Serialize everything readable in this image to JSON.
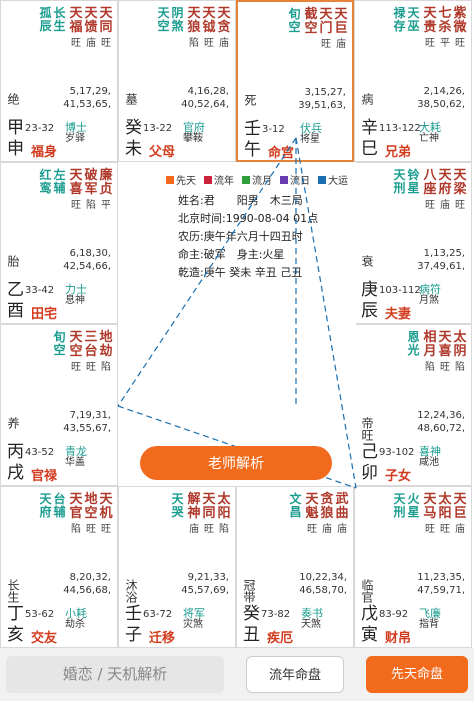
{
  "colors": {
    "accent": "#f26a1b",
    "palace": "#d23c1e",
    "major_star": "#b0382a",
    "minor_star": "#1a9d8f",
    "lucky": "#1a6fb0",
    "transform_bg": "#e8a23a"
  },
  "legend": [
    {
      "label": "先天",
      "color": "#f26a1b"
    },
    {
      "label": "流年",
      "color": "#c8233a"
    },
    {
      "label": "流月",
      "color": "#2f9d3c"
    },
    {
      "label": "流日",
      "color": "#6a3bb0"
    },
    {
      "label": "大运",
      "color": "#1a6fb0"
    }
  ],
  "info": [
    "姓名:君　　阳男　木三局",
    "北京时间:1990-08-04 01点",
    "农历:庚午年六月十四丑时",
    "命主:破军　身主:火星",
    "乾造:庚午 癸未 辛丑 己丑"
  ],
  "cells": [
    {
      "id": "si",
      "stars": [
        [
          "天",
          "同"
        ],
        [
          "天",
          "馈"
        ],
        [
          "天",
          "福"
        ]
      ],
      "brightness": [
        "旺",
        "庙",
        "旺"
      ],
      "minor": [
        [
          "长",
          "生"
        ],
        [
          "孤",
          "辰"
        ]
      ],
      "ages": "5,17,29,\n41,53,65,",
      "cs": "绝",
      "range": "23-32",
      "g1": "博士",
      "g2": "岁驿",
      "stem": "甲",
      "branch": "申",
      "palace": "福身"
    },
    {
      "id": "wei",
      "stars": [
        [
          "天",
          "贪"
        ],
        [
          "天",
          "钺"
        ],
        [
          "天",
          "狼"
        ]
      ],
      "brightness": [
        "庙",
        "旺",
        "陷"
      ],
      "minor": [
        [
          "阴",
          "煞"
        ],
        [
          "天",
          "空"
        ]
      ],
      "ages": "4,16,28,\n40,52,64,",
      "cs": "墓",
      "range": "13-22",
      "g1": "官府",
      "g2": "攀鞍",
      "stem": "癸",
      "branch": "未",
      "palace": "父母"
    },
    {
      "id": "wu",
      "stars": [
        [
          "天",
          "巨"
        ],
        [
          "天",
          "门"
        ],
        [
          "截",
          "空"
        ]
      ],
      "brightness": [
        "庙",
        "旺",
        ""
      ],
      "minor": [
        [
          "旬",
          "空"
        ]
      ],
      "ages": "3,15,27,\n39,51,63,",
      "cs": "死",
      "range": "3-12",
      "g1": "伏兵",
      "g2": "将星",
      "stem": "壬",
      "branch": "午",
      "palace": "命宫",
      "selected": true
    },
    {
      "id": "chen",
      "stars": [
        [
          "紫",
          "微"
        ],
        [
          "七",
          "杀"
        ],
        [
          "天",
          "贵"
        ]
      ],
      "brightness": [
        "旺",
        "平",
        "旺"
      ],
      "minor": [
        [
          "天",
          "巫"
        ],
        [
          "禄",
          "存"
        ]
      ],
      "ages": "2,14,26,\n38,50,62,",
      "cs": "病",
      "range": "113-122",
      "g1": "大耗",
      "g2": "亡神",
      "stem": "辛",
      "branch": "巳",
      "palace": "兄弟"
    },
    {
      "id": "you",
      "stars": [
        [
          "廉",
          "贞"
        ],
        [
          "破",
          "军"
        ],
        [
          "天",
          "喜"
        ]
      ],
      "brightness": [
        "平",
        "陷",
        "旺"
      ],
      "minor": [
        [
          "左",
          "辅"
        ],
        [
          "红",
          "鸾"
        ]
      ],
      "ages": "6,18,30,\n42,54,66,",
      "cs": "胎",
      "range": "33-42",
      "g1": "力士",
      "g2": "息神",
      "stem": "乙",
      "branch": "酉",
      "palace": "田宅"
    },
    {
      "id": "chen2",
      "stars": [
        [
          "天",
          "梁"
        ],
        [
          "天",
          "府"
        ],
        [
          "八",
          "座"
        ]
      ],
      "brightness": [
        "旺",
        "庙",
        "旺"
      ],
      "minor": [
        [
          "铃",
          "星"
        ],
        [
          "天",
          "刑"
        ]
      ],
      "ages": "1,13,25,\n37,49,61,",
      "cs": "衰",
      "range": "103-112",
      "g1": "病符",
      "g2": "月煞",
      "stem": "庚",
      "branch": "辰",
      "palace": "夫妻"
    },
    {
      "id": "xu",
      "stars": [
        [
          "地",
          "劫"
        ],
        [
          "三",
          "台"
        ],
        [
          "天",
          "空"
        ]
      ],
      "brightness": [
        "陷",
        "旺",
        "旺"
      ],
      "minor": [
        [
          "旬",
          "空"
        ]
      ],
      "ages": "7,19,31,\n43,55,67,",
      "cs": "养",
      "range": "43-52",
      "g1": "青龙",
      "g2": "华盖",
      "stem": "丙",
      "branch": "戌",
      "palace": "官禄"
    },
    {
      "id": "mao",
      "stars": [
        [
          "太",
          "阴"
        ],
        [
          "天",
          "喜"
        ],
        [
          "相",
          "月"
        ]
      ],
      "brightness": [
        "陷",
        "旺",
        "陷"
      ],
      "minor": [
        [
          "恩",
          "光"
        ]
      ],
      "ages": "12,24,36,\n48,60,72,",
      "cs": "帝旺",
      "range": "93-102",
      "g1": "喜神",
      "g2": "咸池",
      "stem": "己",
      "branch": "卯",
      "palace": "子女"
    },
    {
      "id": "hai",
      "stars": [
        [
          "天",
          "机"
        ],
        [
          "地",
          "空"
        ],
        [
          "天",
          "官"
        ]
      ],
      "brightness": [
        "旺",
        "旺",
        "陷"
      ],
      "minor": [
        [
          "台",
          "辅"
        ],
        [
          "天",
          "府"
        ]
      ],
      "ages": "8,20,32,\n44,56,68,",
      "cs": "长生",
      "range": "53-62",
      "g1": "小耗",
      "g2": "劫杀",
      "stem": "丁",
      "branch": "亥",
      "palace": "交友"
    },
    {
      "id": "zi",
      "stars": [
        [
          "太",
          "阳"
        ],
        [
          "天",
          "同"
        ],
        [
          "解",
          "神"
        ]
      ],
      "brightness": [
        "陷",
        "旺",
        "庙"
      ],
      "minor": [
        [
          "天",
          "哭"
        ]
      ],
      "ages": "9,21,33,\n45,57,69,",
      "cs": "沐浴",
      "range": "63-72",
      "g1": "将军",
      "g2": "灾煞",
      "stem": "壬",
      "branch": "子",
      "palace": "迁移"
    },
    {
      "id": "chou",
      "stars": [
        [
          "武",
          "曲"
        ],
        [
          "贪",
          "狼"
        ],
        [
          "天",
          "魁"
        ]
      ],
      "brightness": [
        "庙",
        "庙",
        "旺"
      ],
      "minor": [
        [
          "文",
          "昌"
        ]
      ],
      "ages": "10,22,34,\n46,58,70,",
      "cs": "冠带",
      "range": "73-82",
      "g1": "奏书",
      "g2": "天煞",
      "stem": "癸",
      "branch": "丑",
      "palace": "疾厄"
    },
    {
      "id": "yin",
      "stars": [
        [
          "天",
          "巨"
        ],
        [
          "太",
          "阳"
        ],
        [
          "天",
          "马"
        ]
      ],
      "brightness": [
        "庙",
        "旺",
        "旺"
      ],
      "minor": [
        [
          "火",
          "星"
        ],
        [
          "天",
          "刑"
        ]
      ],
      "ages": "11,23,35,\n47,59,71,",
      "cs": "临官",
      "range": "83-92",
      "g1": "飞廉",
      "g2": "指背",
      "stem": "戊",
      "branch": "寅",
      "palace": "财帛"
    }
  ],
  "analyze_button": "老师解析",
  "bottom": {
    "left": "婚恋 / 天机解析",
    "mid": "流年命盘",
    "right": "先天命盘"
  }
}
